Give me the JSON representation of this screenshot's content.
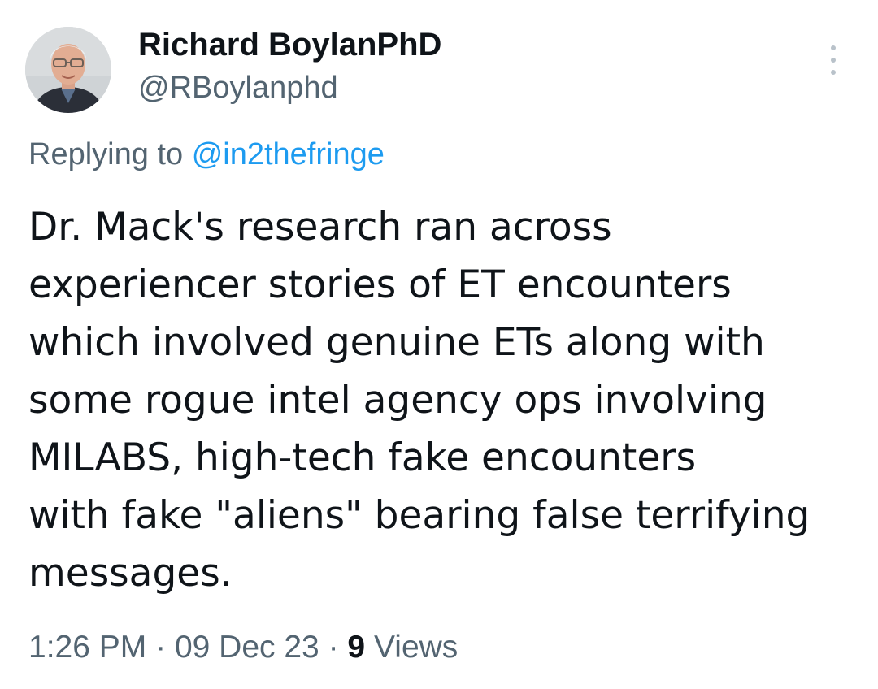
{
  "tweet": {
    "author": {
      "display_name": "Richard BoylanPhD",
      "handle": "@RBoylanphd",
      "avatar_icon": "profile-photo"
    },
    "more_icon": "more-vertical-icon",
    "reply": {
      "prefix": "Replying to",
      "mention": "@in2thefringe"
    },
    "body_lines": [
      "Dr. Mack's research ran across",
      "experiencer stories of ET encounters",
      "which involved genuine ETs along with",
      "some rogue intel agency ops involving",
      "MILABS, high-tech fake encounters",
      "with fake \"aliens\" bearing false terrifying",
      "messages."
    ],
    "meta": {
      "time": "1:26 PM",
      "separator": "·",
      "date": "09 Dec 23",
      "views_count": "9",
      "views_label": "Views"
    }
  },
  "colors": {
    "text_primary": "#0f1419",
    "text_secondary": "#536471",
    "link": "#1d9bf0",
    "icon_muted": "#b9c2ca"
  }
}
